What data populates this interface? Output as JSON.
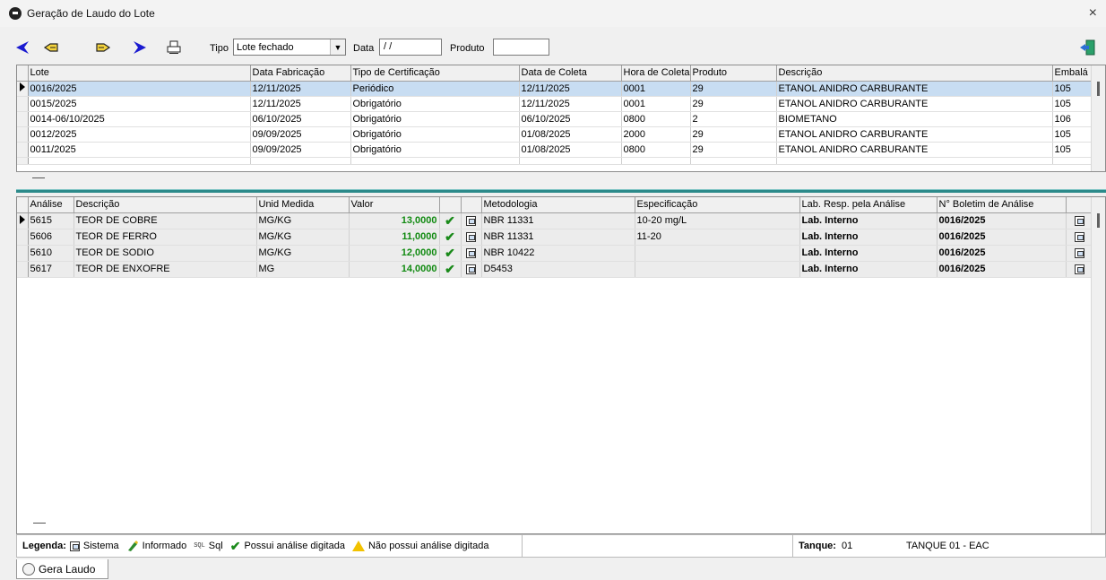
{
  "window": {
    "title": "Geração de Laudo do Lote",
    "close": "×"
  },
  "toolbar": {
    "tipo_label": "Tipo",
    "tipo_value": "Lote fechado",
    "data_label": "Data",
    "data_value": "/ /",
    "produto_label": "Produto",
    "produto_value": ""
  },
  "lotes": {
    "columns": [
      "Lote",
      "Data Fabricação",
      "Tipo de Certificação",
      "Data de Coleta",
      "Hora de Coleta",
      "Produto",
      "Descrição",
      "Embalá"
    ],
    "rows": [
      [
        "0016/2025",
        "12/11/2025",
        "Periódico",
        "12/11/2025",
        "0001",
        "29",
        "ETANOL ANIDRO CARBURANTE",
        "105"
      ],
      [
        "0015/2025",
        "12/11/2025",
        "Obrigatório",
        "12/11/2025",
        "0001",
        "29",
        "ETANOL ANIDRO CARBURANTE",
        "105"
      ],
      [
        "0014-06/10/2025",
        "06/10/2025",
        "Obrigatório",
        "06/10/2025",
        "0800",
        "2",
        "BIOMETANO",
        "106"
      ],
      [
        "0012/2025",
        "09/09/2025",
        "Obrigatório",
        "01/08/2025",
        "2000",
        "29",
        "ETANOL ANIDRO CARBURANTE",
        "105"
      ],
      [
        "0011/2025",
        "09/09/2025",
        "Obrigatório",
        "01/08/2025",
        "0800",
        "29",
        "ETANOL ANIDRO CARBURANTE",
        "105"
      ]
    ]
  },
  "analises": {
    "columns": [
      "Análise",
      "Descrição",
      "Unid Medida",
      "Valor",
      "",
      "",
      "Metodologia",
      "Especificação",
      "Lab. Resp. pela Análise",
      "N° Boletim de Análise"
    ],
    "rows": [
      [
        "5615",
        "TEOR DE COBRE",
        "MG/KG",
        "13,0000",
        "NBR 11331",
        "10-20 mg/L",
        "Lab. Interno",
        "0016/2025"
      ],
      [
        "5606",
        "TEOR DE FERRO",
        "MG/KG",
        "11,0000",
        "NBR 11331",
        "11-20",
        "Lab. Interno",
        "0016/2025"
      ],
      [
        "5610",
        "TEOR DE SODIO",
        "MG/KG",
        "12,0000",
        "NBR 10422",
        "",
        "Lab. Interno",
        "0016/2025"
      ],
      [
        "5617",
        "TEOR DE ENXOFRE",
        "MG",
        "14,0000",
        "D5453",
        "",
        "Lab. Interno",
        "0016/2025"
      ]
    ]
  },
  "legend": {
    "label": "Legenda:",
    "sistema": "Sistema",
    "informado": "Informado",
    "sql_icon": "SQL",
    "sql": "Sql",
    "possui": "Possui análise digitada",
    "nao_possui": "Não possui análise digitada",
    "tanque_label": "Tanque:",
    "tanque_num": "01",
    "tanque_name": "TANQUE 01 - EAC"
  },
  "tab": {
    "label": "Gera Laudo"
  },
  "icons": {
    "prev": "arrow-left-icon",
    "first": "hand-left-icon",
    "last": "hand-right-icon",
    "next": "arrow-right-icon",
    "print": "printer-icon",
    "exit": "exit-door-icon"
  },
  "colors": {
    "nav_arrow": "#1a1ad0",
    "selected_row": "#c8ddf2",
    "splitter": "#2c8a8a",
    "value_green": "#118a11"
  }
}
